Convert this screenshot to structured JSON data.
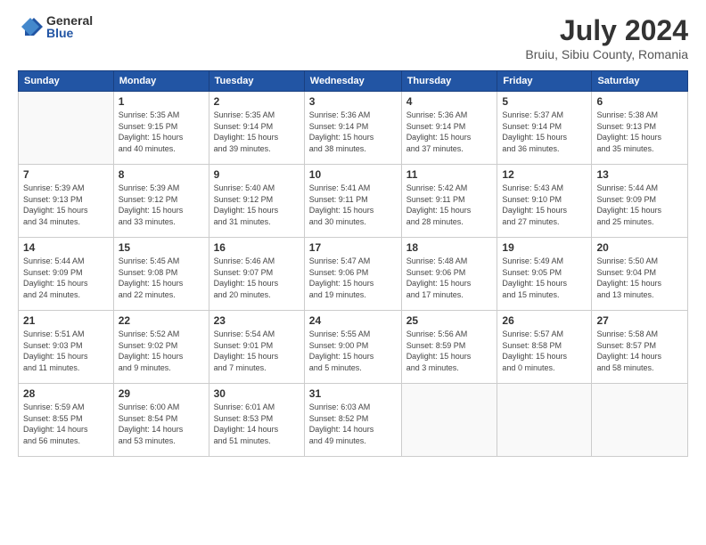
{
  "header": {
    "logo_general": "General",
    "logo_blue": "Blue",
    "title": "July 2024",
    "location": "Bruiu, Sibiu County, Romania"
  },
  "weekdays": [
    "Sunday",
    "Monday",
    "Tuesday",
    "Wednesday",
    "Thursday",
    "Friday",
    "Saturday"
  ],
  "weeks": [
    [
      {
        "day": "",
        "info": ""
      },
      {
        "day": "1",
        "info": "Sunrise: 5:35 AM\nSunset: 9:15 PM\nDaylight: 15 hours\nand 40 minutes."
      },
      {
        "day": "2",
        "info": "Sunrise: 5:35 AM\nSunset: 9:14 PM\nDaylight: 15 hours\nand 39 minutes."
      },
      {
        "day": "3",
        "info": "Sunrise: 5:36 AM\nSunset: 9:14 PM\nDaylight: 15 hours\nand 38 minutes."
      },
      {
        "day": "4",
        "info": "Sunrise: 5:36 AM\nSunset: 9:14 PM\nDaylight: 15 hours\nand 37 minutes."
      },
      {
        "day": "5",
        "info": "Sunrise: 5:37 AM\nSunset: 9:14 PM\nDaylight: 15 hours\nand 36 minutes."
      },
      {
        "day": "6",
        "info": "Sunrise: 5:38 AM\nSunset: 9:13 PM\nDaylight: 15 hours\nand 35 minutes."
      }
    ],
    [
      {
        "day": "7",
        "info": "Sunrise: 5:39 AM\nSunset: 9:13 PM\nDaylight: 15 hours\nand 34 minutes."
      },
      {
        "day": "8",
        "info": "Sunrise: 5:39 AM\nSunset: 9:12 PM\nDaylight: 15 hours\nand 33 minutes."
      },
      {
        "day": "9",
        "info": "Sunrise: 5:40 AM\nSunset: 9:12 PM\nDaylight: 15 hours\nand 31 minutes."
      },
      {
        "day": "10",
        "info": "Sunrise: 5:41 AM\nSunset: 9:11 PM\nDaylight: 15 hours\nand 30 minutes."
      },
      {
        "day": "11",
        "info": "Sunrise: 5:42 AM\nSunset: 9:11 PM\nDaylight: 15 hours\nand 28 minutes."
      },
      {
        "day": "12",
        "info": "Sunrise: 5:43 AM\nSunset: 9:10 PM\nDaylight: 15 hours\nand 27 minutes."
      },
      {
        "day": "13",
        "info": "Sunrise: 5:44 AM\nSunset: 9:09 PM\nDaylight: 15 hours\nand 25 minutes."
      }
    ],
    [
      {
        "day": "14",
        "info": "Sunrise: 5:44 AM\nSunset: 9:09 PM\nDaylight: 15 hours\nand 24 minutes."
      },
      {
        "day": "15",
        "info": "Sunrise: 5:45 AM\nSunset: 9:08 PM\nDaylight: 15 hours\nand 22 minutes."
      },
      {
        "day": "16",
        "info": "Sunrise: 5:46 AM\nSunset: 9:07 PM\nDaylight: 15 hours\nand 20 minutes."
      },
      {
        "day": "17",
        "info": "Sunrise: 5:47 AM\nSunset: 9:06 PM\nDaylight: 15 hours\nand 19 minutes."
      },
      {
        "day": "18",
        "info": "Sunrise: 5:48 AM\nSunset: 9:06 PM\nDaylight: 15 hours\nand 17 minutes."
      },
      {
        "day": "19",
        "info": "Sunrise: 5:49 AM\nSunset: 9:05 PM\nDaylight: 15 hours\nand 15 minutes."
      },
      {
        "day": "20",
        "info": "Sunrise: 5:50 AM\nSunset: 9:04 PM\nDaylight: 15 hours\nand 13 minutes."
      }
    ],
    [
      {
        "day": "21",
        "info": "Sunrise: 5:51 AM\nSunset: 9:03 PM\nDaylight: 15 hours\nand 11 minutes."
      },
      {
        "day": "22",
        "info": "Sunrise: 5:52 AM\nSunset: 9:02 PM\nDaylight: 15 hours\nand 9 minutes."
      },
      {
        "day": "23",
        "info": "Sunrise: 5:54 AM\nSunset: 9:01 PM\nDaylight: 15 hours\nand 7 minutes."
      },
      {
        "day": "24",
        "info": "Sunrise: 5:55 AM\nSunset: 9:00 PM\nDaylight: 15 hours\nand 5 minutes."
      },
      {
        "day": "25",
        "info": "Sunrise: 5:56 AM\nSunset: 8:59 PM\nDaylight: 15 hours\nand 3 minutes."
      },
      {
        "day": "26",
        "info": "Sunrise: 5:57 AM\nSunset: 8:58 PM\nDaylight: 15 hours\nand 0 minutes."
      },
      {
        "day": "27",
        "info": "Sunrise: 5:58 AM\nSunset: 8:57 PM\nDaylight: 14 hours\nand 58 minutes."
      }
    ],
    [
      {
        "day": "28",
        "info": "Sunrise: 5:59 AM\nSunset: 8:55 PM\nDaylight: 14 hours\nand 56 minutes."
      },
      {
        "day": "29",
        "info": "Sunrise: 6:00 AM\nSunset: 8:54 PM\nDaylight: 14 hours\nand 53 minutes."
      },
      {
        "day": "30",
        "info": "Sunrise: 6:01 AM\nSunset: 8:53 PM\nDaylight: 14 hours\nand 51 minutes."
      },
      {
        "day": "31",
        "info": "Sunrise: 6:03 AM\nSunset: 8:52 PM\nDaylight: 14 hours\nand 49 minutes."
      },
      {
        "day": "",
        "info": ""
      },
      {
        "day": "",
        "info": ""
      },
      {
        "day": "",
        "info": ""
      }
    ]
  ]
}
